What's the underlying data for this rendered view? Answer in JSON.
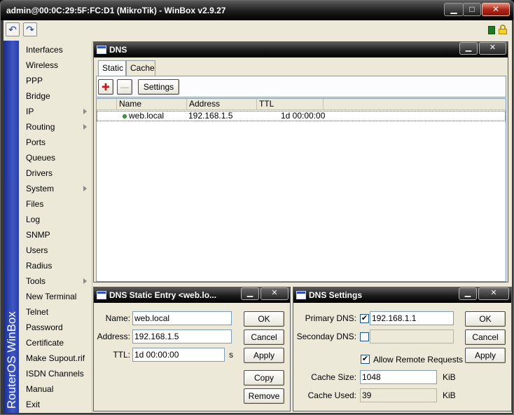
{
  "window": {
    "title": "admin@00:0C:29:5F:FC:D1 (MikroTik) - WinBox v2.9.27",
    "min_glyph": "▁",
    "max_glyph": "□",
    "close_glyph": "✕"
  },
  "toolbar": {
    "undo_glyph": "↶",
    "redo_glyph": "↷"
  },
  "sidebar": {
    "brand": "RouterOS WinBox",
    "items": [
      {
        "label": "Interfaces",
        "has_submenu": false
      },
      {
        "label": "Wireless",
        "has_submenu": false
      },
      {
        "label": "PPP",
        "has_submenu": false
      },
      {
        "label": "Bridge",
        "has_submenu": false
      },
      {
        "label": "IP",
        "has_submenu": true
      },
      {
        "label": "Routing",
        "has_submenu": true
      },
      {
        "label": "Ports",
        "has_submenu": false
      },
      {
        "label": "Queues",
        "has_submenu": false
      },
      {
        "label": "Drivers",
        "has_submenu": false
      },
      {
        "label": "System",
        "has_submenu": true
      },
      {
        "label": "Files",
        "has_submenu": false
      },
      {
        "label": "Log",
        "has_submenu": false
      },
      {
        "label": "SNMP",
        "has_submenu": false
      },
      {
        "label": "Users",
        "has_submenu": false
      },
      {
        "label": "Radius",
        "has_submenu": false
      },
      {
        "label": "Tools",
        "has_submenu": true
      },
      {
        "label": "New Terminal",
        "has_submenu": false
      },
      {
        "label": "Telnet",
        "has_submenu": false
      },
      {
        "label": "Password",
        "has_submenu": false
      },
      {
        "label": "Certificate",
        "has_submenu": false
      },
      {
        "label": "Make Supout.rif",
        "has_submenu": false
      },
      {
        "label": "ISDN Channels",
        "has_submenu": false
      },
      {
        "label": "Manual",
        "has_submenu": false
      },
      {
        "label": "Exit",
        "has_submenu": false
      }
    ]
  },
  "dns_window": {
    "title": "DNS",
    "minimize_glyph": "▁",
    "close_glyph": "✕",
    "tabs": [
      {
        "label": "Static",
        "active": true
      },
      {
        "label": "Cache",
        "active": false
      }
    ],
    "add_glyph": "✚",
    "remove_glyph": "—",
    "settings_label": "Settings",
    "columns": [
      "Name",
      "Address",
      "TTL"
    ],
    "rows": [
      {
        "name": "web.local",
        "address": "192.168.1.5",
        "ttl": "1d 00:00:00"
      }
    ]
  },
  "static_entry": {
    "title": "DNS Static Entry <web.lo...",
    "minimize_glyph": "▁",
    "close_glyph": "✕",
    "name_label": "Name:",
    "name_value": "web.local",
    "address_label": "Address:",
    "address_value": "192.168.1.5",
    "ttl_label": "TTL:",
    "ttl_value": "1d 00:00:00",
    "ttl_unit": "s",
    "ok_label": "OK",
    "cancel_label": "Cancel",
    "apply_label": "Apply",
    "copy_label": "Copy",
    "remove_label": "Remove"
  },
  "dns_settings": {
    "title": "DNS Settings",
    "minimize_glyph": "▁",
    "close_glyph": "✕",
    "primary_label": "Primary DNS:",
    "primary_checked": true,
    "primary_value": "192.168.1.1",
    "secondary_label": "Seconday DNS:",
    "secondary_checked": false,
    "secondary_value": "",
    "allow_remote_label": "Allow Remote Requests",
    "allow_remote_checked": true,
    "cache_size_label": "Cache Size:",
    "cache_size_value": "1048",
    "cache_size_unit": "KiB",
    "cache_used_label": "Cache Used:",
    "cache_used_value": "39",
    "cache_used_unit": "KiB",
    "ok_label": "OK",
    "cancel_label": "Cancel",
    "apply_label": "Apply",
    "check_glyph": "✔"
  }
}
